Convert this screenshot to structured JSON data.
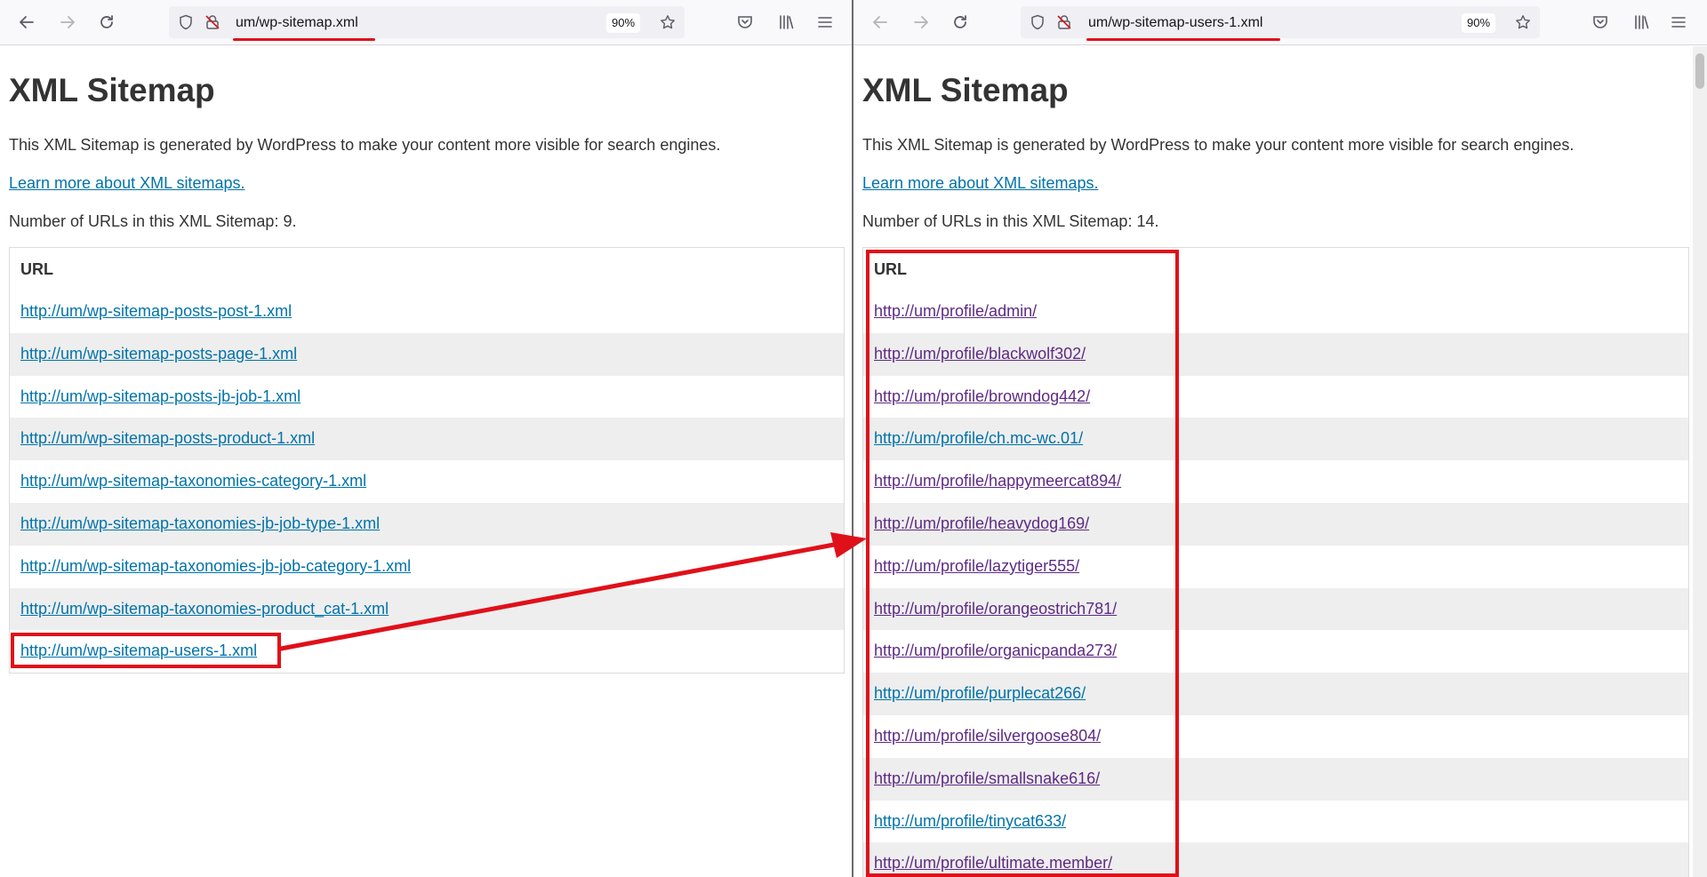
{
  "colors": {
    "link": "#0073aa",
    "link_visited": "#5e2a84",
    "annotation": "#e0101a",
    "row_alt": "#eeeeee"
  },
  "left": {
    "address": "um/wp-sitemap.xml",
    "zoom": "90%",
    "title": "XML Sitemap",
    "description": "This XML Sitemap is generated by WordPress to make your content more visible for search engines.",
    "learn_more": "Learn more about XML sitemaps.",
    "count_text": "Number of URLs in this XML Sitemap: 9.",
    "column_header": "URL",
    "urls": [
      "http://um/wp-sitemap-posts-post-1.xml",
      "http://um/wp-sitemap-posts-page-1.xml",
      "http://um/wp-sitemap-posts-jb-job-1.xml",
      "http://um/wp-sitemap-posts-product-1.xml",
      "http://um/wp-sitemap-taxonomies-category-1.xml",
      "http://um/wp-sitemap-taxonomies-jb-job-type-1.xml",
      "http://um/wp-sitemap-taxonomies-jb-job-category-1.xml",
      "http://um/wp-sitemap-taxonomies-product_cat-1.xml",
      "http://um/wp-sitemap-users-1.xml"
    ]
  },
  "right": {
    "address": "um/wp-sitemap-users-1.xml",
    "zoom": "90%",
    "title": "XML Sitemap",
    "description": "This XML Sitemap is generated by WordPress to make your content more visible for search engines.",
    "learn_more": "Learn more about XML sitemaps.",
    "count_text": "Number of URLs in this XML Sitemap: 14.",
    "column_header": "URL",
    "urls": [
      "http://um/profile/admin/",
      "http://um/profile/blackwolf302/",
      "http://um/profile/browndog442/",
      "http://um/profile/ch.mc-wc.01/",
      "http://um/profile/happymeercat894/",
      "http://um/profile/heavydog169/",
      "http://um/profile/lazytiger555/",
      "http://um/profile/orangeostrich781/",
      "http://um/profile/organicpanda273/",
      "http://um/profile/purplecat266/",
      "http://um/profile/silvergoose804/",
      "http://um/profile/smallsnake616/",
      "http://um/profile/tinycat633/",
      "http://um/profile/ultimate.member/"
    ],
    "visited": [
      true,
      true,
      true,
      false,
      true,
      true,
      true,
      true,
      true,
      false,
      true,
      true,
      false,
      true
    ]
  }
}
